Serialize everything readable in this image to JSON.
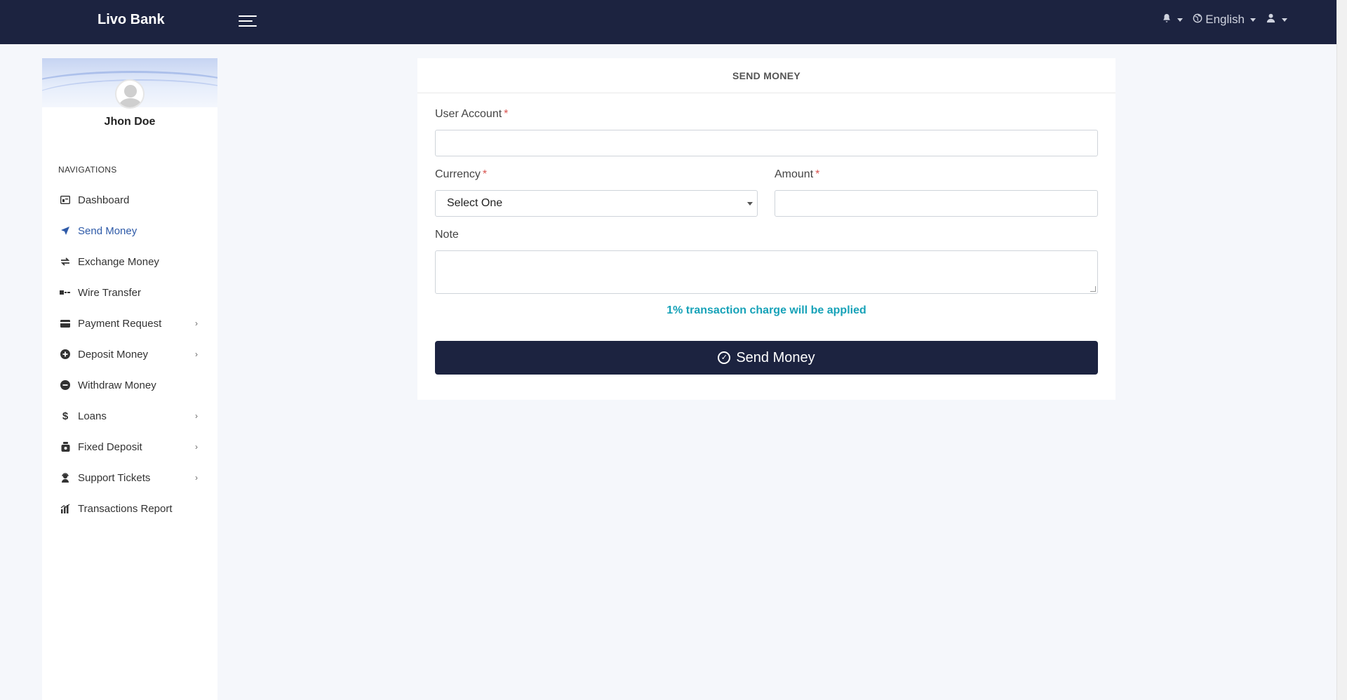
{
  "brand": {
    "name": "Livo Bank"
  },
  "topbar": {
    "language": "English"
  },
  "profile": {
    "name": "Jhon Doe"
  },
  "sidebar": {
    "title": "NAVIGATIONS",
    "items": [
      {
        "label": "Dashboard",
        "icon": "dashboard-icon",
        "has_submenu": false,
        "active": false
      },
      {
        "label": "Send Money",
        "icon": "send-icon",
        "has_submenu": false,
        "active": true
      },
      {
        "label": "Exchange Money",
        "icon": "exchange-icon",
        "has_submenu": false,
        "active": false
      },
      {
        "label": "Wire Transfer",
        "icon": "wire-transfer-icon",
        "has_submenu": false,
        "active": false
      },
      {
        "label": "Payment Request",
        "icon": "credit-card-icon",
        "has_submenu": true,
        "active": false
      },
      {
        "label": "Deposit Money",
        "icon": "plus-circle-icon",
        "has_submenu": true,
        "active": false
      },
      {
        "label": "Withdraw Money",
        "icon": "minus-circle-icon",
        "has_submenu": false,
        "active": false
      },
      {
        "label": "Loans",
        "icon": "dollar-icon",
        "has_submenu": true,
        "active": false
      },
      {
        "label": "Fixed Deposit",
        "icon": "piggy-bank-icon",
        "has_submenu": true,
        "active": false
      },
      {
        "label": "Support Tickets",
        "icon": "headset-icon",
        "has_submenu": true,
        "active": false
      },
      {
        "label": "Transactions Report",
        "icon": "chart-icon",
        "has_submenu": false,
        "active": false
      }
    ]
  },
  "form": {
    "title": "SEND MONEY",
    "user_account_label": "User Account",
    "user_account_value": "",
    "currency_label": "Currency",
    "currency_selected": "Select One",
    "amount_label": "Amount",
    "amount_value": "",
    "note_label": "Note",
    "note_value": "",
    "required_mark": "*",
    "charge_note": "1% transaction charge will be applied",
    "submit_label": "Send Money"
  },
  "colors": {
    "navbar": "#1c2340",
    "accent": "#2e5aa8",
    "info_text": "#17a2b8",
    "required": "#d9534f"
  }
}
